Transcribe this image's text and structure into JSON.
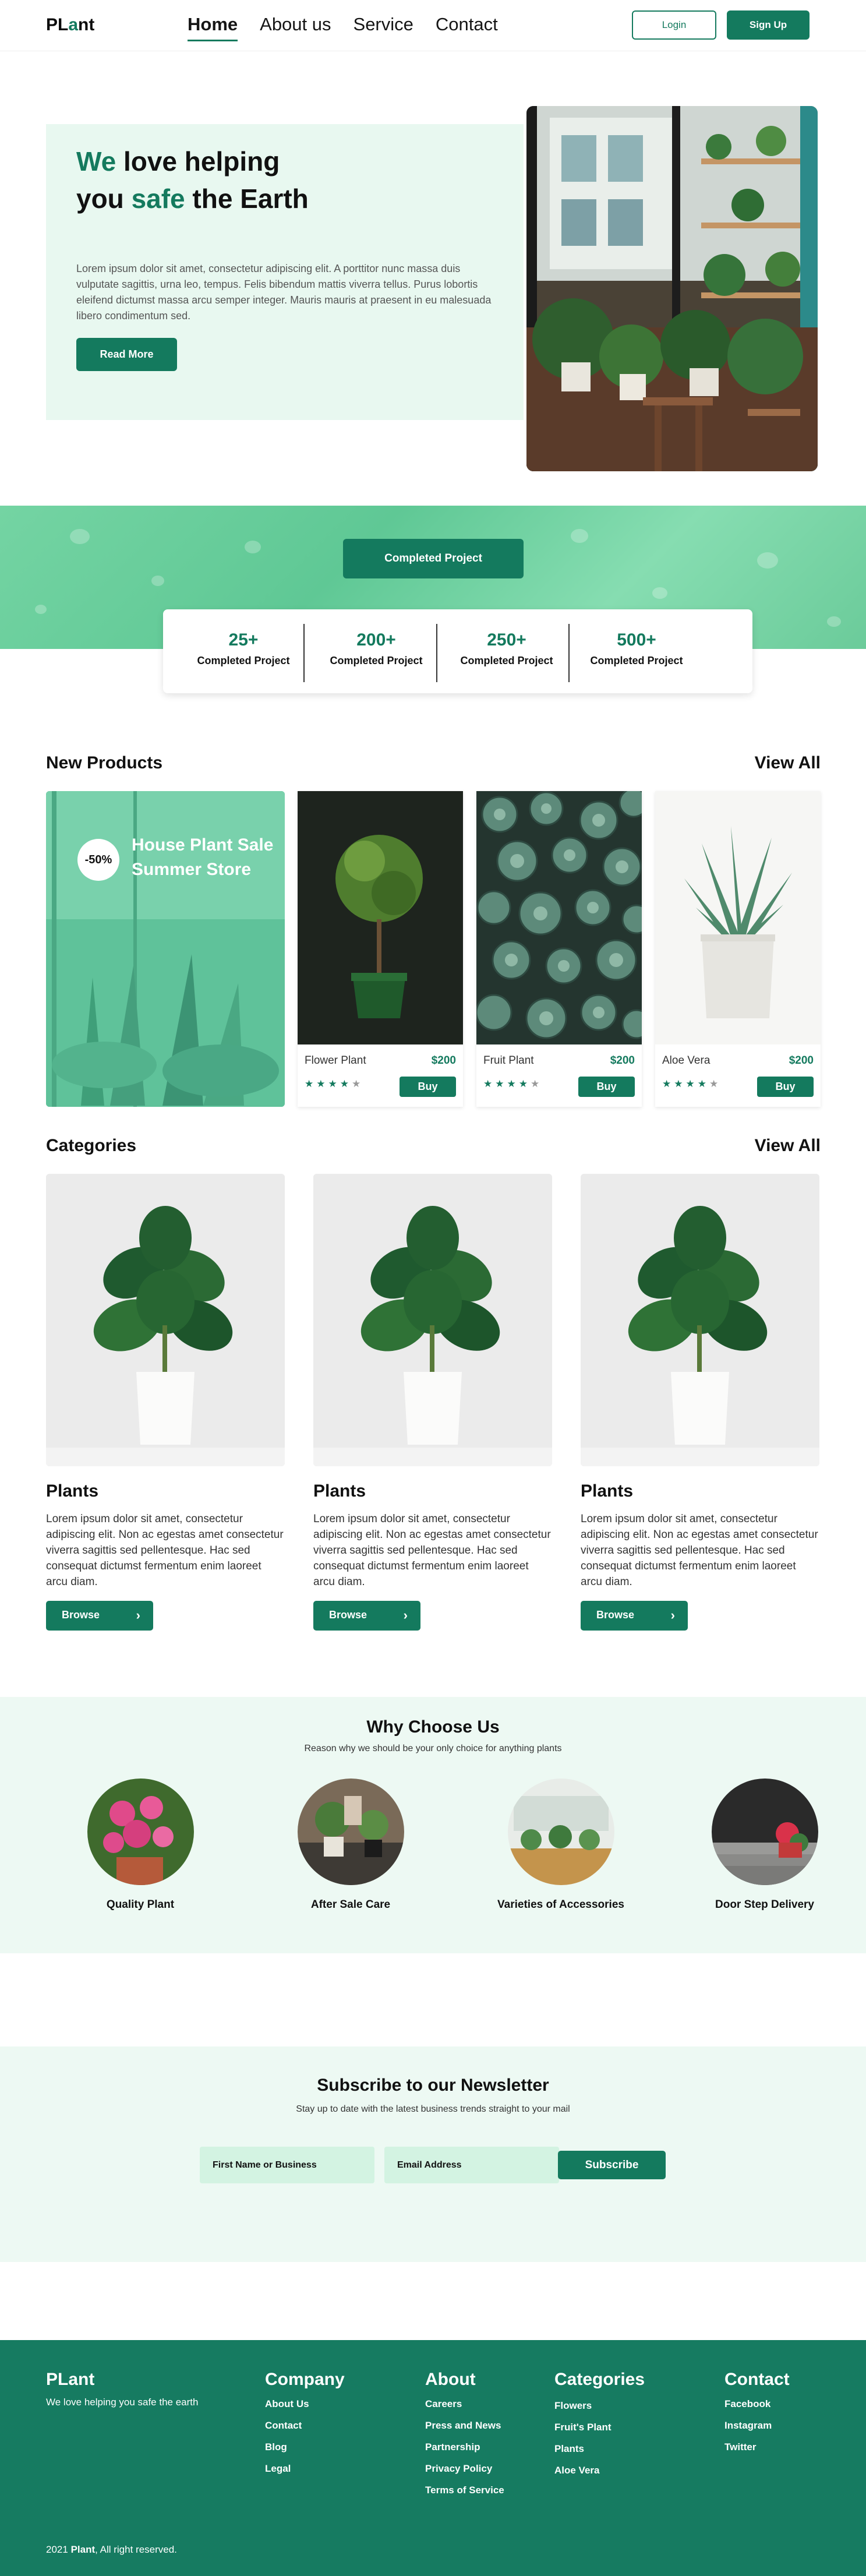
{
  "header": {
    "logo_main": "PL",
    "logo_accent": "a",
    "logo_end": "nt",
    "nav": [
      "Home",
      "About us",
      "Service",
      "Contact"
    ],
    "login_label": "Login",
    "signup_label": "Sign Up"
  },
  "hero": {
    "title_w1": "We",
    "title_mid": " love helping you ",
    "title_w2": "safe",
    "title_end": " the Earth",
    "text": "Lorem ipsum dolor sit amet, consectetur adipiscing elit. A porttitor nunc massa duis vulputate sagittis, urna leo, tempus. Felis bibendum mattis viverra tellus. Purus lobortis eleifend dictumst massa arcu semper integer. Mauris mauris at praesent in eu malesuada libero condimentum sed.",
    "button_label": "Read More"
  },
  "stats": {
    "button_label": "Completed Project",
    "items": [
      {
        "value": "25+",
        "label": "Completed Project"
      },
      {
        "value": "200+",
        "label": "Completed Project"
      },
      {
        "value": "250+",
        "label": "Completed Project"
      },
      {
        "value": "500+",
        "label": "Completed Project"
      }
    ]
  },
  "products": {
    "title": "New Products",
    "view_all": "View All",
    "promo_badge": "-50%",
    "promo_text": "House Plant Sale Summer Store",
    "items": [
      {
        "name": "Flower Plant",
        "price": "$200",
        "rating": 4,
        "buy": "Buy"
      },
      {
        "name": "Fruit Plant",
        "price": "$200",
        "rating": 4,
        "buy": "Buy"
      },
      {
        "name": "Aloe Vera",
        "price": "$200",
        "rating": 4,
        "buy": "Buy"
      }
    ]
  },
  "categories": {
    "title": "Categories",
    "view_all": "View All",
    "items": [
      {
        "title": "Plants",
        "text": "Lorem ipsum dolor sit amet, consectetur adipiscing elit. Non ac egestas amet consectetur viverra sagittis sed pellentesque. Hac sed consequat dictumst fermentum enim laoreet arcu diam.",
        "button": "Browse"
      },
      {
        "title": "Plants",
        "text": "Lorem ipsum dolor sit amet, consectetur adipiscing elit. Non ac egestas amet consectetur viverra sagittis sed pellentesque. Hac sed consequat dictumst fermentum enim laoreet arcu diam.",
        "button": "Browse"
      },
      {
        "title": "Plants",
        "text": "Lorem ipsum dolor sit amet, consectetur adipiscing elit. Non ac egestas amet consectetur viverra sagittis sed pellentesque. Hac sed consequat dictumst fermentum enim laoreet arcu diam.",
        "button": "Browse"
      }
    ]
  },
  "why": {
    "title": "Why Choose Us",
    "subtitle": "Reason why we should be your only choice for anything plants",
    "items": [
      "Quality Plant",
      "After Sale Care",
      "Varieties of Accessories",
      "Door Step Delivery"
    ]
  },
  "newsletter": {
    "title": "Subscribe to our Newsletter",
    "subtitle": "Stay up to date with the latest business trends straight to your mail",
    "name_placeholder": "First Name or Business",
    "email_placeholder": "Email Address",
    "button_label": "Subscribe"
  },
  "footer": {
    "brand": "PLant",
    "tagline": "We love helping you safe the earth",
    "columns": [
      {
        "title": "Company",
        "links": [
          "About Us",
          "Contact",
          "Blog",
          "Legal"
        ]
      },
      {
        "title": "About",
        "links": [
          "Careers",
          "Press and News",
          "Partnership",
          "Privacy Policy",
          "Terms of Service"
        ]
      },
      {
        "title": "Categories",
        "links": [
          "Flowers",
          "Fruit's Plant",
          "Plants",
          "Aloe Vera"
        ]
      },
      {
        "title": "Contact",
        "links": [
          "Facebook",
          "Instagram",
          "Twitter"
        ]
      }
    ],
    "copy_year": "2021",
    "copy_brand": "Plant",
    "copy_rest": ", All right reserved."
  },
  "colors": {
    "accent": "#147a5e",
    "hero_bg": "#e8f8f0",
    "band": "#6bcb9a",
    "footer": "#167b61"
  }
}
